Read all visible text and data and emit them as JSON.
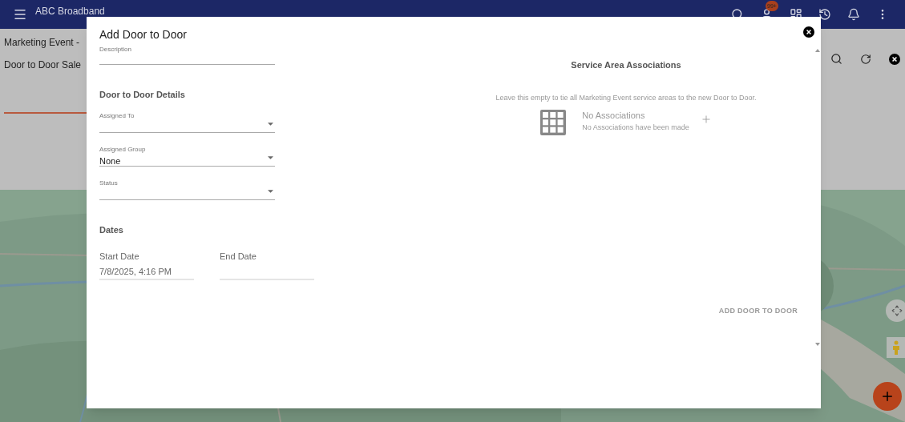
{
  "app_bar": {
    "title": "ABC Broadband",
    "badge": "99+"
  },
  "page": {
    "title": "Marketing Event -",
    "subtitle": "Door to Door Sale"
  },
  "dialog": {
    "title": "Add Door to Door",
    "description": {
      "label": "Description"
    },
    "details_heading": "Door to Door Details",
    "selects": [
      {
        "label": "Assigned To"
      },
      {
        "label": "Assigned Group",
        "value": "None"
      },
      {
        "label": "Status"
      }
    ],
    "dates_heading": "Dates",
    "dates": [
      {
        "label": "Start Date",
        "value": "7/8/2025, 4:16 PM"
      },
      {
        "label": "End Date"
      }
    ],
    "associations": {
      "heading": "Service Area Associations",
      "hint": "Leave this empty to tie all Marketing Event service areas to the new Door to Door.",
      "empty_title": "No Associations",
      "empty_text": "No Associations have been made"
    },
    "submit": "ADD DOOR TO DOOR"
  }
}
